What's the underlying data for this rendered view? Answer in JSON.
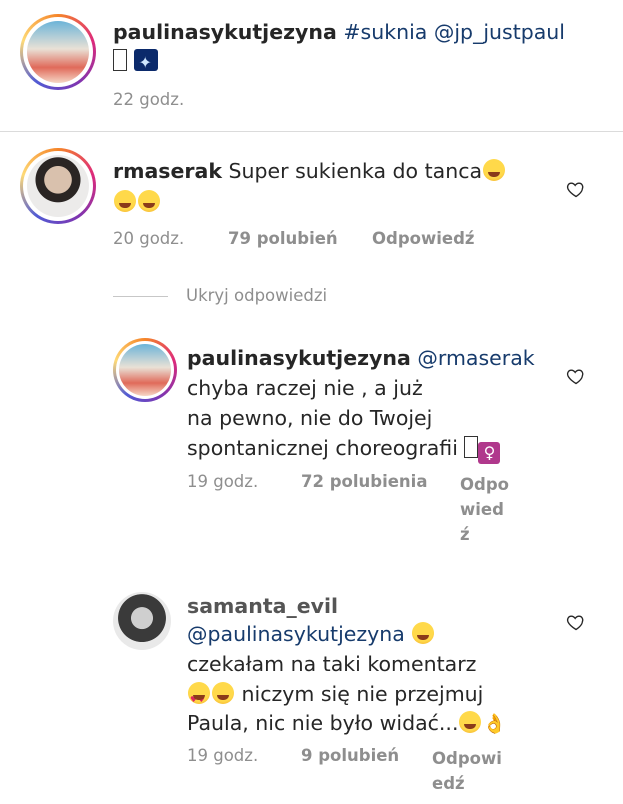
{
  "post": {
    "author": "paulinasykutjezyna",
    "text": "#suknia @jp_justpaul",
    "time": "22 godz."
  },
  "comment": {
    "author": "rmaserak",
    "text": "Super sukienka do tanca",
    "time": "20 godz.",
    "likes": "79 polubień",
    "reply": "Odpowiedź"
  },
  "hide_replies": "Ukryj odpowiedzi",
  "replies": [
    {
      "author": "paulinasykutjezyna",
      "mention": "@rmaserak",
      "line1": "chyba raczej nie , a już",
      "line2": "na pewno, nie do Twojej",
      "line3": "spontanicznej choreografii",
      "symbol": "♀",
      "time": "19 godz.",
      "likes": "72 polubienia",
      "reply_l1": "Odpo",
      "reply_l2": "wied",
      "reply_l3": "ź"
    },
    {
      "author": "samanta_evil",
      "mention": "@paulinasykutjezyna",
      "line1": "czekałam na taki komentarz",
      "line2": "niczym się nie przejmuj",
      "line3": "Paula, nic nie było widać...",
      "time": "19 godz.",
      "likes": "9 polubień",
      "reply_l1": "Odpowi",
      "reply_l2": "edź"
    }
  ],
  "icons": [
    "heart-outline-icon"
  ],
  "colors": {
    "mention": "#173b6c",
    "meta": "#8e8e8e",
    "divider": "#dbdbdb"
  }
}
